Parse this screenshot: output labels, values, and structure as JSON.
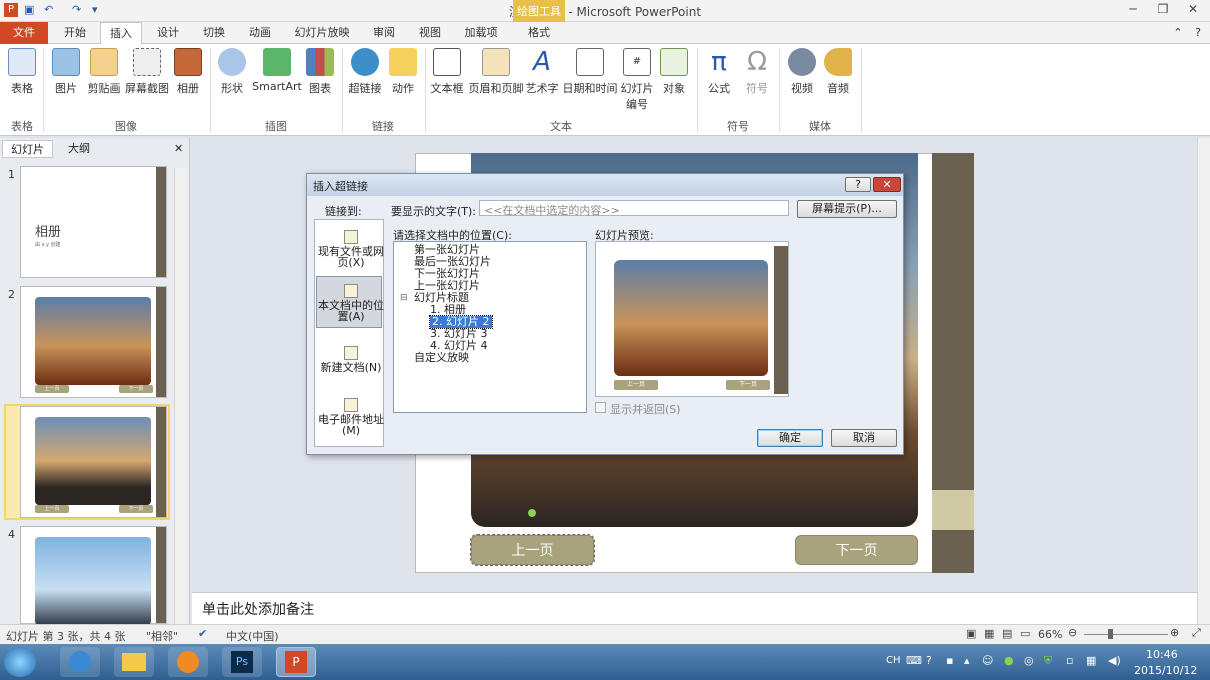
{
  "titlebar": {
    "title": "演示文稿2 - Microsoft PowerPoint",
    "context_band": "绘图工具"
  },
  "tabs": [
    "文件",
    "开始",
    "插入",
    "设计",
    "切换",
    "动画",
    "幻灯片放映",
    "审阅",
    "视图",
    "加载项",
    "格式"
  ],
  "ribbon": {
    "buttons": [
      "表格",
      "图片",
      "剪贴画",
      "屏幕截图",
      "相册",
      "形状",
      "SmartArt",
      "图表",
      "超链接",
      "动作",
      "文本框",
      "页眉和页脚",
      "艺术字",
      "日期和时间",
      "幻灯片编号",
      "对象",
      "公式",
      "符号",
      "视频",
      "音频"
    ],
    "groups": [
      "表格",
      "图像",
      "插图",
      "链接",
      "文本",
      "符号",
      "媒体"
    ]
  },
  "panel": {
    "tab_slides": "幻灯片",
    "tab_outline": "大纲",
    "slide_numbers": [
      "1",
      "2",
      "3",
      "4"
    ],
    "slide1_title": "相册",
    "slide1_sub": "由 x.y 创建",
    "thumb_prev": "上一页",
    "thumb_next": "下一页"
  },
  "slide": {
    "prev": "上一页",
    "next": "下一页"
  },
  "notes": "单击此处添加备注",
  "status": {
    "slide_info": "幻灯片 第 3 张，共 4 张",
    "theme": "\"相邻\"",
    "language": "中文(中国)",
    "zoom": "66%"
  },
  "dialog": {
    "title": "插入超链接",
    "help": "?",
    "close": "✕",
    "link_to": "链接到:",
    "display_text_label": "要显示的文字(T):",
    "display_text_value": "<<在文档中选定的内容>>",
    "screentip": "屏幕提示(P)...",
    "link_items": [
      [
        "现有文件或网",
        "页(X)"
      ],
      [
        "本文档中的位",
        "置(A)"
      ],
      [
        "新建文档(N)"
      ],
      [
        "电子邮件地址",
        "(M)"
      ]
    ],
    "place_label": "请选择文档中的位置(C):",
    "tree": [
      "第一张幻灯片",
      "最后一张幻灯片",
      "下一张幻灯片",
      "上一张幻灯片",
      "幻灯片标题",
      "1. 相册",
      "2. 幻灯片 2",
      "3. 幻灯片 3",
      "4. 幻灯片 4",
      "自定义放映"
    ],
    "preview_label": "幻灯片预览:",
    "preview_prev": "上一页",
    "preview_next": "下一页",
    "show_return": "显示并返回(S)",
    "ok": "确定",
    "cancel": "取消"
  },
  "taskbar": {
    "lang": "CH",
    "time": "10:46",
    "date": "2015/10/12"
  }
}
